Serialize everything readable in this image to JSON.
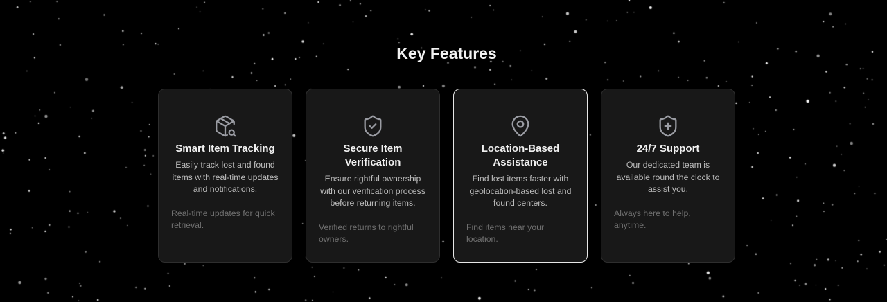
{
  "section": {
    "title": "Key Features"
  },
  "features": [
    {
      "icon": "package-search-icon",
      "title": "Smart Item Tracking",
      "description": "Easily track lost and found items with real-time updates and notifications.",
      "note": "Real-time updates for quick retrieval."
    },
    {
      "icon": "shield-check-icon",
      "title": "Secure Item Verification",
      "description": "Ensure rightful ownership with our verification process before returning items.",
      "note": "Verified returns to rightful owners."
    },
    {
      "icon": "map-pin-icon",
      "title": "Location-Based Assistance",
      "description": "Find lost items faster with geolocation-based lost and found centers.",
      "note": "Find items near your location."
    },
    {
      "icon": "shield-plus-icon",
      "title": "24/7 Support",
      "description": "Our dedicated team is available round the clock to assist you.",
      "note": "Always here to help, anytime."
    }
  ],
  "colors": {
    "background": "#000000",
    "card": "#181818",
    "active_border": "#e6e6e6",
    "icon": "#9a9ca3"
  }
}
